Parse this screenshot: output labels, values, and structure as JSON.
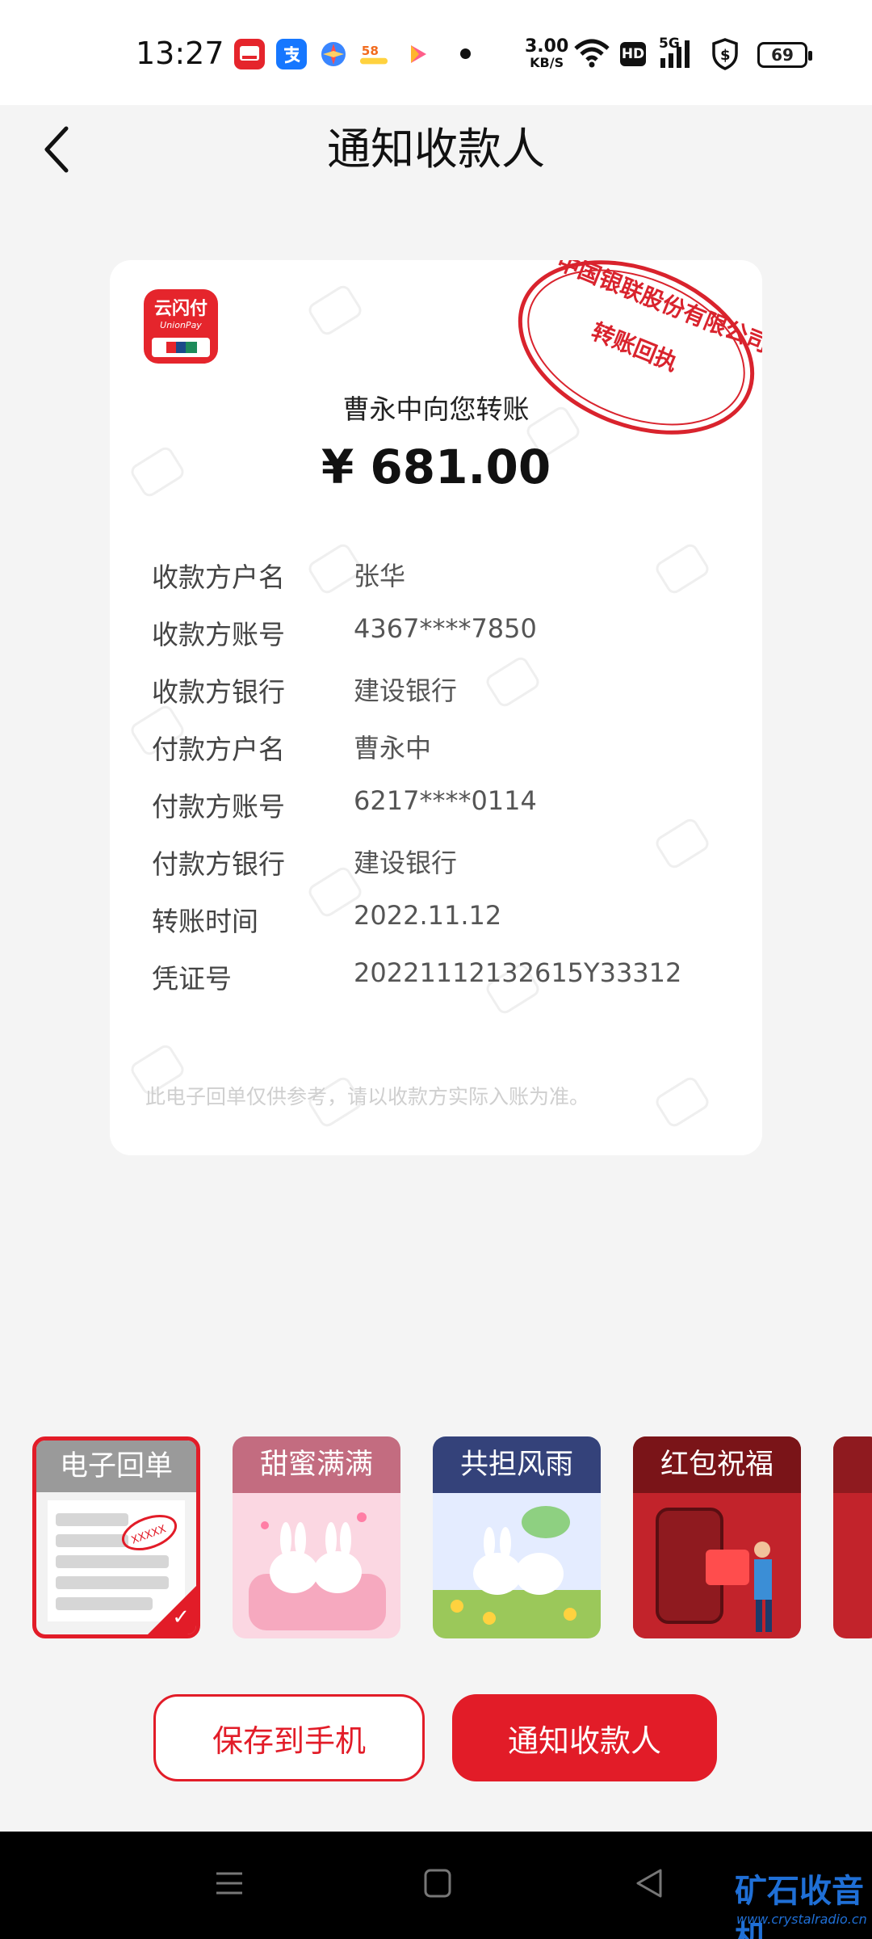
{
  "status_bar": {
    "time": "13:27",
    "net_speed_value": "3.00",
    "net_speed_unit": "KB/S",
    "signal_label": "5G",
    "hd_label": "HD",
    "battery": "69",
    "app_icons": [
      "unionpay-app-icon",
      "alipay-app-icon",
      "compass-app-icon",
      "58-app-icon",
      "video-app-icon"
    ]
  },
  "header": {
    "title": "通知收款人"
  },
  "receipt": {
    "logo_text_cn": "云闪付",
    "logo_text_en": "UnionPay",
    "stamp_line1": "中国银联股份有限公司",
    "stamp_line2": "转账回执",
    "title": "曹永中向您转账",
    "amount": "¥ 681.00",
    "rows": [
      {
        "label": "收款方户名",
        "value": "张华"
      },
      {
        "label": "收款方账号",
        "value": "4367****7850"
      },
      {
        "label": "收款方银行",
        "value": "建设银行"
      },
      {
        "label": "付款方户名",
        "value": "曹永中"
      },
      {
        "label": "付款方账号",
        "value": "6217****0114"
      },
      {
        "label": "付款方银行",
        "value": "建设银行"
      },
      {
        "label": "转账时间",
        "value": "2022.11.12"
      },
      {
        "label": "凭证号",
        "value": "20221112132615Y33312"
      }
    ],
    "disclaimer": "此电子回单仅供参考，请以收款方实际入账为准。"
  },
  "templates": [
    {
      "label": "电子回单",
      "selected": true,
      "stamp_text": "XXXXX"
    },
    {
      "label": "甜蜜满满",
      "selected": false
    },
    {
      "label": "共担风雨",
      "selected": false
    },
    {
      "label": "红包祝福",
      "selected": false
    }
  ],
  "buttons": {
    "save": "保存到手机",
    "notify": "通知收款人"
  },
  "watermark_site": {
    "name": "矿石收音机",
    "url": "www.crystalradio.cn"
  },
  "colors": {
    "brand_red": "#e21c28",
    "background": "#f4f4f4"
  }
}
